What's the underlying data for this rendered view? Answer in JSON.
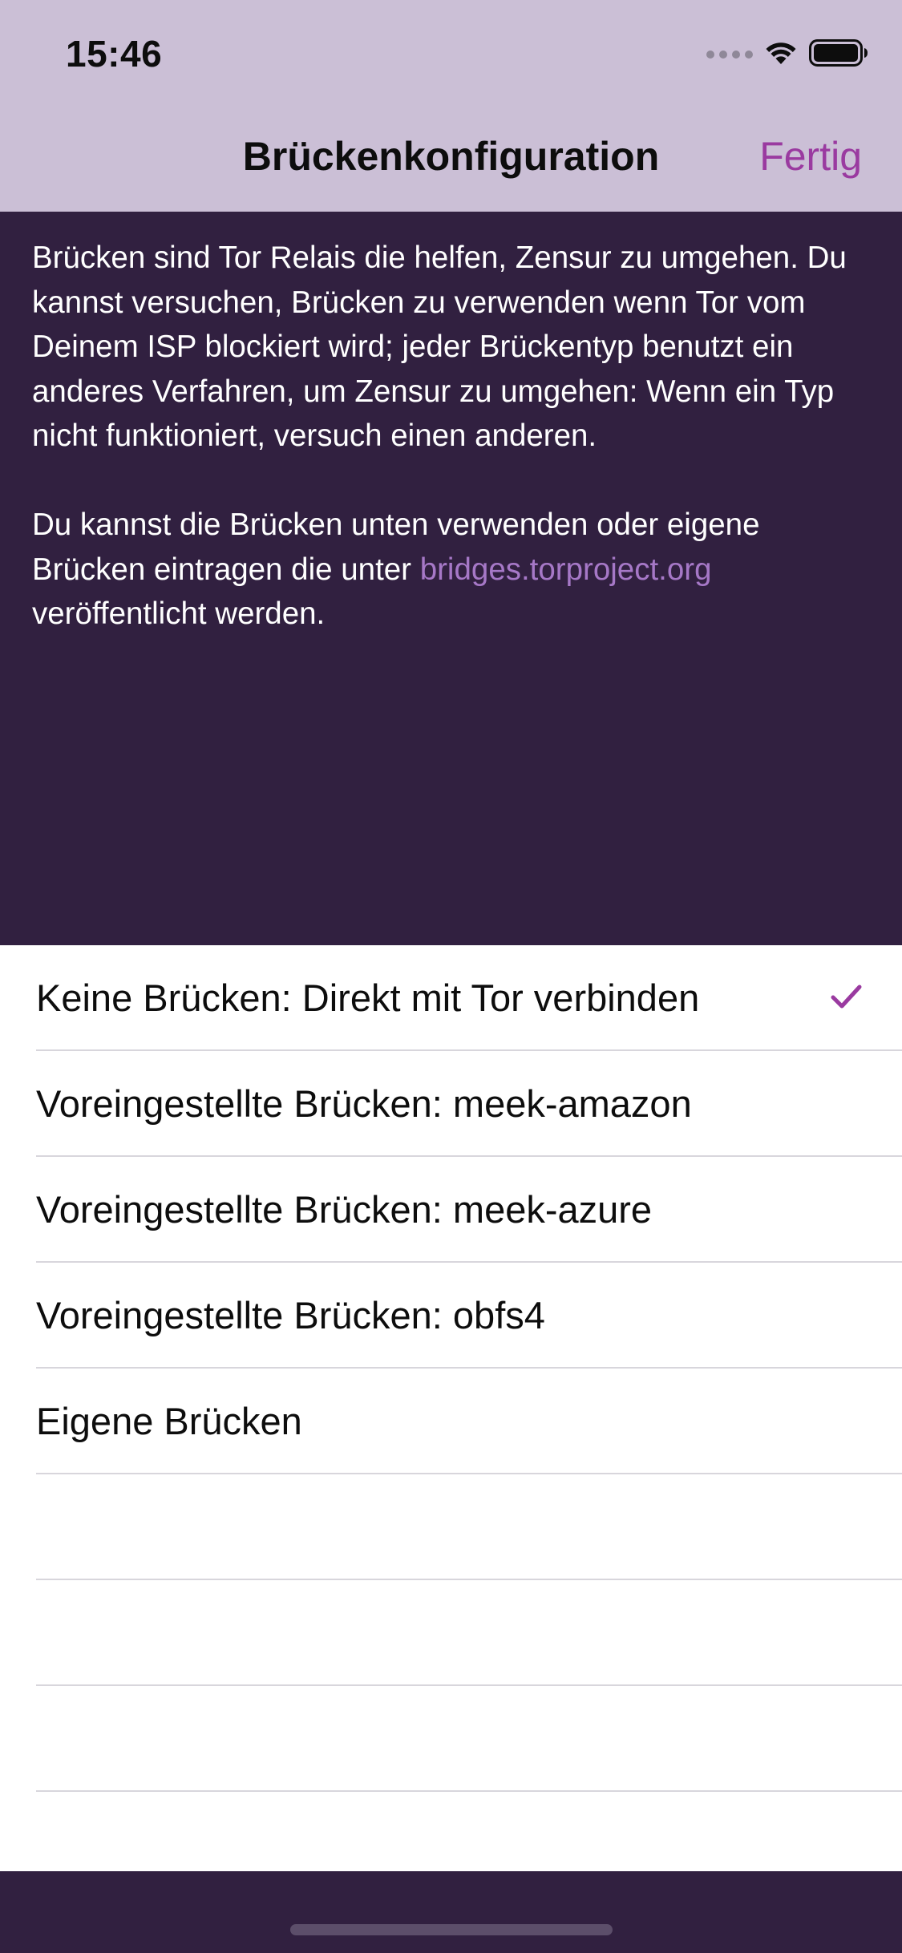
{
  "status_bar": {
    "time": "15:46"
  },
  "nav": {
    "title": "Brückenkonfiguration",
    "done_label": "Fertig"
  },
  "description": {
    "paragraph1": "Brücken sind Tor Relais die helfen, Zensur zu umgehen. Du kannst versuchen, Brücken zu verwenden wenn Tor vom Deinem ISP blockiert wird; jeder Brückentyp benutzt ein anderes Verfahren, um Zensur zu umgehen: Wenn ein Typ nicht funktioniert, versuch einen anderen.",
    "paragraph2_prefix": "Du kannst die Brücken unten verwenden oder eigene Brücken eintragen die unter",
    "link_text": "bridges.torproject.org",
    "paragraph2_suffix": "veröffentlicht werden."
  },
  "options": [
    {
      "label": "Keine Brücken: Direkt mit Tor verbinden",
      "selected": true
    },
    {
      "label": "Voreingestellte Brücken: meek-amazon",
      "selected": false
    },
    {
      "label": "Voreingestellte Brücken: meek-azure",
      "selected": false
    },
    {
      "label": "Voreingestellte Brücken: obfs4",
      "selected": false
    },
    {
      "label": "Eigene Brücken",
      "selected": false
    }
  ],
  "colors": {
    "accent": "#9a3aa0",
    "header_bg": "#cbbfd6",
    "dark_bg": "#312040",
    "link": "#a678c7"
  },
  "icons": {
    "selected_mark": "checkmark-icon",
    "signal": "cellular-signal-icon",
    "wifi": "wifi-icon",
    "battery": "battery-icon"
  }
}
